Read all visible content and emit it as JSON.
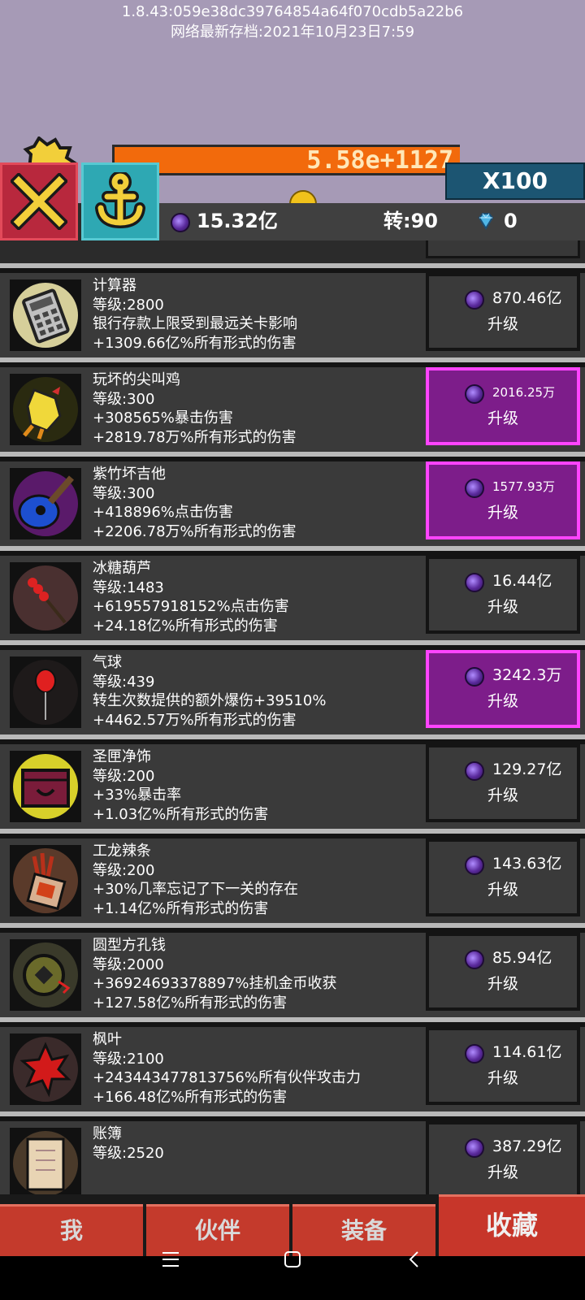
{
  "header": {
    "version": "1.8.43:059e38dc39764854a64f070cdb5a22b6",
    "save_time": "网络最新存档:2021年10月23日7:59",
    "damage": "5.58e+1127",
    "multiplier": "X100"
  },
  "stats": {
    "currency": "15.32亿",
    "rebirth": "转:90",
    "diamonds": "0"
  },
  "items": [
    {
      "name": "计算器",
      "level": "等级:2800",
      "line1": "银行存款上限受到最远关卡影响",
      "line2": "+1309.66亿%所有形式的伤害",
      "cost": "870.46亿",
      "button": "升级",
      "affordable": false
    },
    {
      "name": "玩坏的尖叫鸡",
      "level": "等级:300",
      "line1": "+308565%暴击伤害",
      "line2": "+2819.78万%所有形式的伤害",
      "cost": "2016.25万",
      "button": "升级",
      "affordable": true
    },
    {
      "name": "紫竹坏吉他",
      "level": "等级:300",
      "line1": "+418896%点击伤害",
      "line2": "+2206.78万%所有形式的伤害",
      "cost": "1577.93万",
      "button": "升级",
      "affordable": true
    },
    {
      "name": "冰糖葫芦",
      "level": "等级:1483",
      "line1": "+619557918152%点击伤害",
      "line2": "+24.18亿%所有形式的伤害",
      "cost": "16.44亿",
      "button": "升级",
      "affordable": false
    },
    {
      "name": "气球",
      "level": "等级:439",
      "line1": "转生次数提供的额外爆伤+39510%",
      "line2": "+4462.57万%所有形式的伤害",
      "cost": "3242.3万",
      "button": "升级",
      "affordable": true
    },
    {
      "name": "圣匣净饰",
      "level": "等级:200",
      "line1": "+33%暴击率",
      "line2": "+1.03亿%所有形式的伤害",
      "cost": "129.27亿",
      "button": "升级",
      "affordable": false
    },
    {
      "name": "工龙辣条",
      "level": "等级:200",
      "line1": "+30%几率忘记了下一关的存在",
      "line2": "+1.14亿%所有形式的伤害",
      "cost": "143.63亿",
      "button": "升级",
      "affordable": false
    },
    {
      "name": "圆型方孔钱",
      "level": "等级:2000",
      "line1": "+36924693378897%挂机金币收获",
      "line2": "+127.58亿%所有形式的伤害",
      "cost": "85.94亿",
      "button": "升级",
      "affordable": false
    },
    {
      "name": "枫叶",
      "level": "等级:2100",
      "line1": "+243443477813756%所有伙伴攻击力",
      "line2": "+166.48亿%所有形式的伤害",
      "cost": "114.61亿",
      "button": "升级",
      "affordable": false
    },
    {
      "name": "账簿",
      "level": "等级:2520",
      "line1": "",
      "line2": "",
      "cost": "387.29亿",
      "button": "升级",
      "affordable": false
    }
  ],
  "tabs": {
    "me": "我",
    "partners": "伙伴",
    "equipment": "装备",
    "collection": "收藏"
  }
}
